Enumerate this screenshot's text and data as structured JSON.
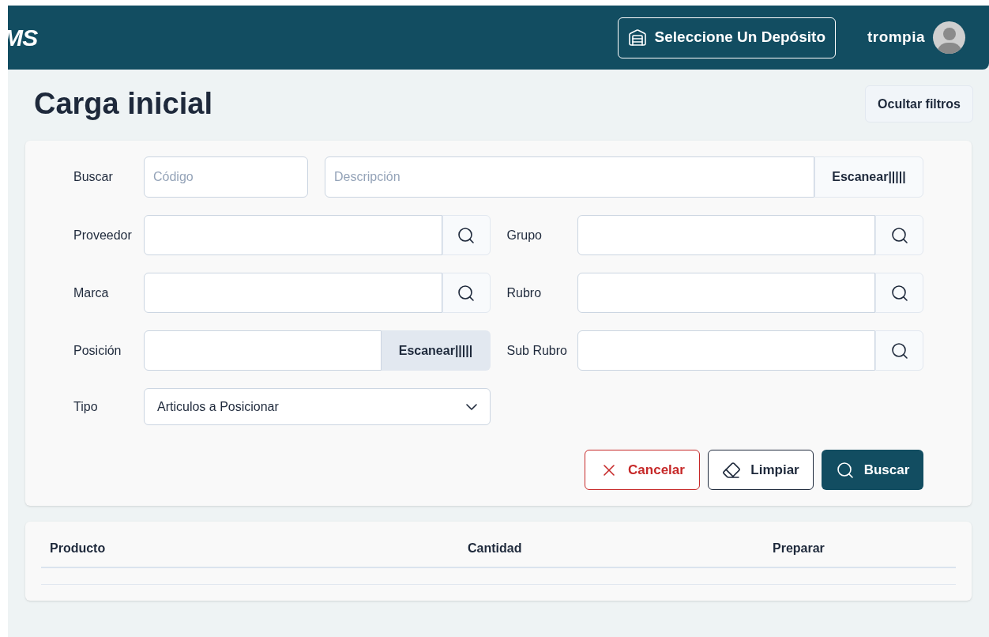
{
  "header": {
    "logo": "MS",
    "deposit_button": "Seleccione Un Depósito",
    "user": "trompia"
  },
  "page": {
    "title": "Carga inicial",
    "filter_toggle": "Ocultar filtros"
  },
  "search": {
    "label": "Buscar",
    "code_placeholder": "Código",
    "description_placeholder": "Descripción",
    "scan_button": "Escanear|||||"
  },
  "fields": [
    {
      "label": "Proveedor",
      "kind": "lookup"
    },
    {
      "label": "Grupo",
      "kind": "lookup"
    },
    {
      "label": "Marca",
      "kind": "lookup"
    },
    {
      "label": "Rubro",
      "kind": "lookup"
    },
    {
      "label": "Posición",
      "kind": "scan",
      "button": "Escanear|||||"
    },
    {
      "label": "Sub Rubro",
      "kind": "lookup"
    },
    {
      "label": "Tipo",
      "kind": "select",
      "value": "Articulos a Posicionar"
    }
  ],
  "actions": [
    {
      "kind": "cancel",
      "label": "Cancelar"
    },
    {
      "kind": "clear",
      "label": "Limpiar"
    },
    {
      "kind": "search",
      "label": "Buscar"
    }
  ],
  "table": {
    "columns": [
      "Producto",
      "Cantidad",
      "Preparar"
    ]
  }
}
